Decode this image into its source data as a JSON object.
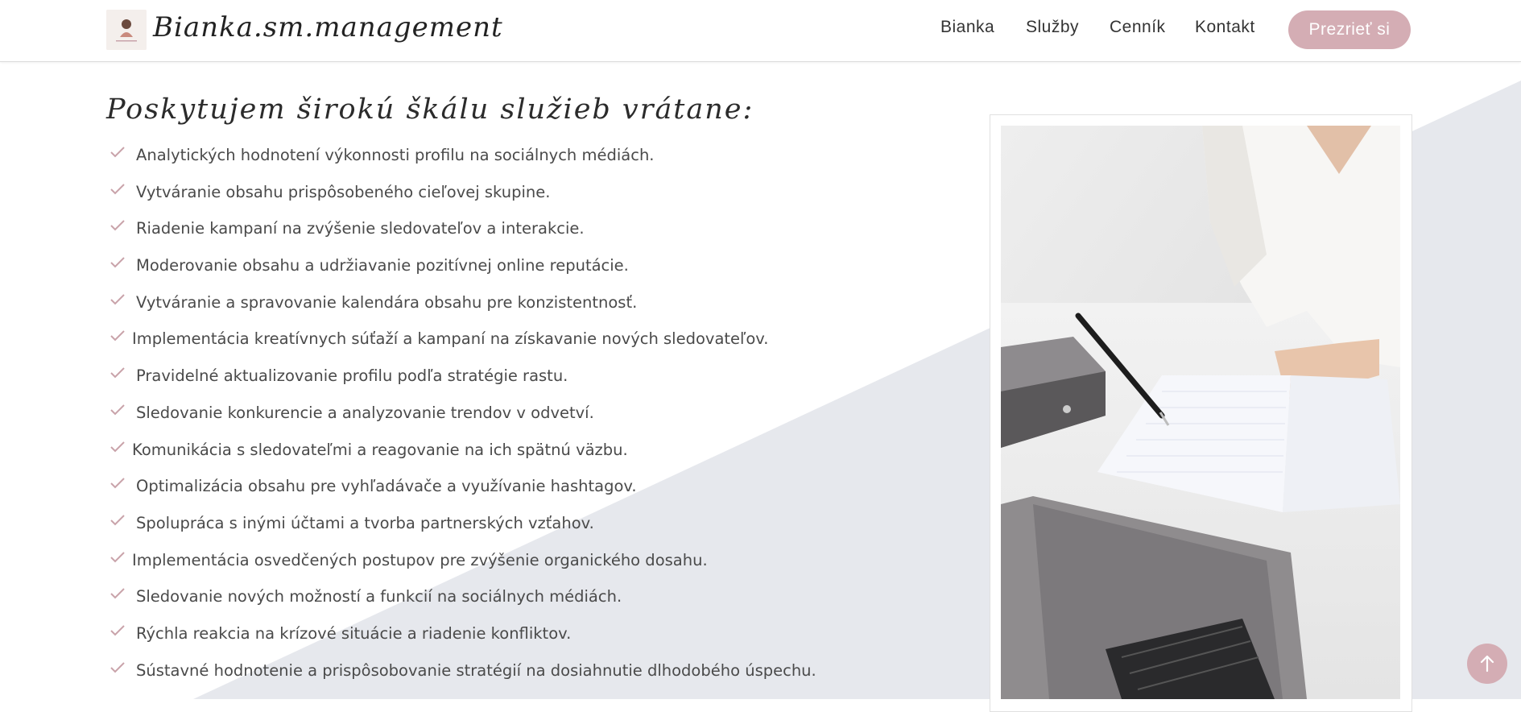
{
  "header": {
    "brand": "Bianka.sm.management",
    "nav": [
      "Bianka",
      "Služby",
      "Cenník",
      "Kontakt"
    ],
    "cta": "Prezrieť si"
  },
  "main": {
    "heading": "Poskytujem širokú škálu služieb vrátane:",
    "services": [
      "Analytických hodnotení výkonnosti profilu na sociálnych médiách.",
      "Vytváranie obsahu prispôsobeného cieľovej skupine.",
      "Riadenie kampaní na zvýšenie sledovateľov a interakcie.",
      "Moderovanie obsahu a udržiavanie pozitívnej online reputácie.",
      "Vytváranie a spravovanie kalendára obsahu pre konzistentnosť.",
      "Implementácia kreatívnych súťaží a kampaní na získavanie nových sledovateľov.",
      "Pravidelné aktualizovanie profilu podľa stratégie rastu.",
      "Sledovanie konkurencie a analyzovanie trendov v odvetví.",
      "Komunikácia s sledovateľmi a reagovanie na ich spätnú väzbu.",
      "Optimalizácia obsahu pre vyhľadávače a využívanie hashtagov.",
      "Spolupráca s inými účtami a tvorba partnerských vzťahov.",
      "Implementácia osvedčených postupov pre zvýšenie organického dosahu.",
      "Sledovanie nových možností a funkcií na sociálnych médiách.",
      "Rýchla reakcia na krízové situácie a riadenie konfliktov.",
      "Sústavné hodnotenie a prispôsobovanie stratégií na dosiahnutie dlhodobého úspechu."
    ]
  },
  "icons": {
    "check": "check-icon",
    "scroll_top": "arrow-up-icon"
  },
  "colors": {
    "accent": "#d4adb4",
    "check": "#c9a3aa",
    "diagonal_bg": "#e6e8ed",
    "text": "#4a4a4a"
  }
}
